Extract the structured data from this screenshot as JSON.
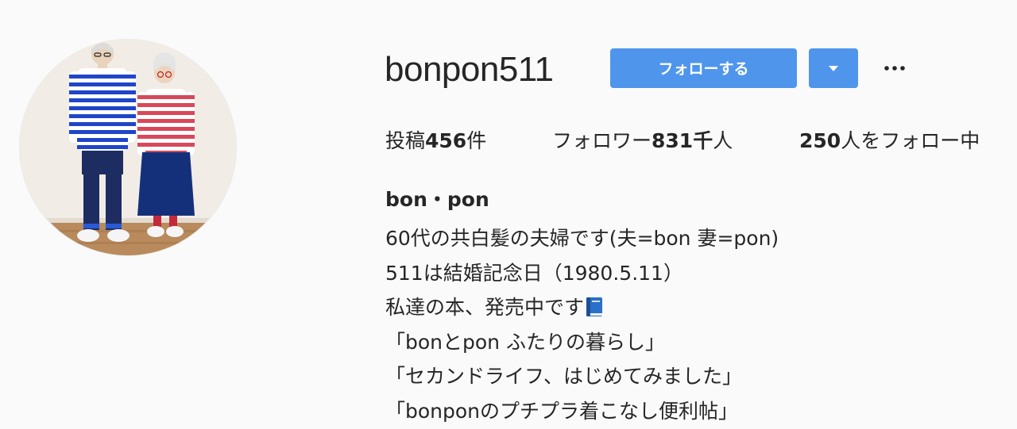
{
  "profile": {
    "username": "bonpon511",
    "follow_label": "フォローする",
    "dropdown_icon": "caret-down-icon",
    "more_icon": "ellipsis-icon"
  },
  "stats": {
    "posts_prefix": "投稿",
    "posts_count": "456",
    "posts_suffix": "件",
    "followers_prefix": "フォロワー",
    "followers_count": "831千",
    "followers_suffix": "人",
    "following_count": "250",
    "following_suffix": "人をフォロー中"
  },
  "bio": {
    "full_name": "bon・pon",
    "lines": [
      "60代の共白髪の夫婦です(夫=bon 妻=pon)",
      "511は結婚記念日（1980.5.11）",
      "私達の本、発売中です",
      "「bonとpon ふたりの暮らし」",
      "「セカンドライフ、はじめてみました」",
      "「bonponのプチプラ着こなし便利帖」"
    ],
    "line3_icon": "blue-book-icon"
  },
  "colors": {
    "accent": "#4f95ec",
    "text": "#262626",
    "background": "#fafafa"
  }
}
